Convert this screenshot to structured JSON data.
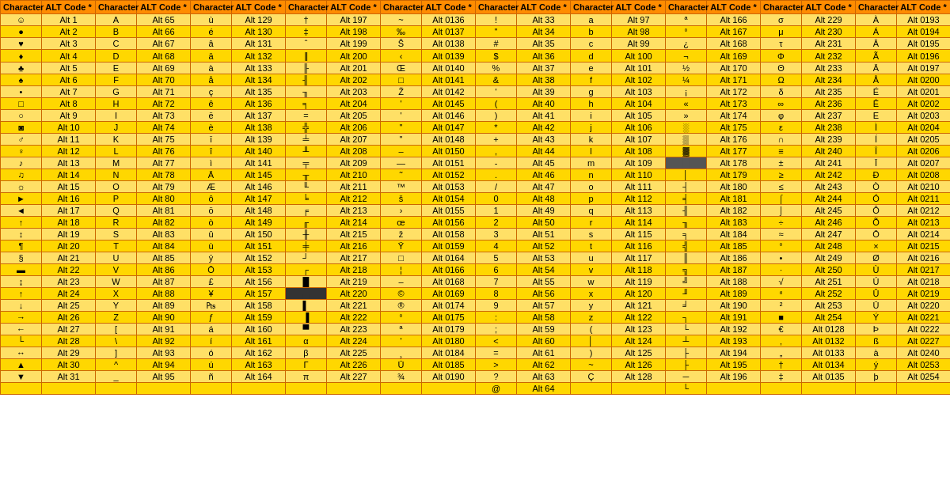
{
  "table": {
    "headers": [
      "Character",
      "ALT Code *",
      "Character",
      "ALT Code *",
      "Character",
      "ALT Code *",
      "Character",
      "ALT Code *",
      "Character",
      "ALT Code *"
    ],
    "rows": [
      [
        "☺",
        "Alt 1",
        "A",
        "Alt 65",
        "ù",
        "Alt 129",
        "†",
        "Alt 197",
        "~",
        "Alt 0136"
      ],
      [
        "●",
        "Alt 2",
        "B",
        "Alt 66",
        "é",
        "Alt 130",
        "‡",
        "Alt 198",
        "‰",
        "Alt 0137"
      ],
      [
        "♥",
        "Alt 3",
        "C",
        "Alt 67",
        "â",
        "Alt 131",
        "ˆ",
        "Alt 199",
        "Š",
        "Alt 0138"
      ],
      [
        "♦",
        "Alt 4",
        "D",
        "Alt 68",
        "ä",
        "Alt 132",
        "‖",
        "Alt 200",
        "‹",
        "Alt 0139"
      ],
      [
        "♣",
        "Alt 5",
        "E",
        "Alt 69",
        "à",
        "Alt 133",
        "╟",
        "Alt 201",
        "Œ",
        "Alt 0140"
      ],
      [
        "♠",
        "Alt 6",
        "F",
        "Alt 70",
        "å",
        "Alt 134",
        "╢",
        "Alt 202",
        "□",
        "Alt 0141"
      ],
      [
        "•",
        "Alt 7",
        "G",
        "Alt 71",
        "ç",
        "Alt 135",
        "╖",
        "Alt 203",
        "Ž",
        "Alt 0142"
      ],
      [
        "□",
        "Alt 8",
        "H",
        "Alt 72",
        "ê",
        "Alt 136",
        "╕",
        "Alt 204",
        "'",
        "Alt 0145"
      ],
      [
        "○",
        "Alt 9",
        "I",
        "Alt 73",
        "ë",
        "Alt 137",
        "=",
        "Alt 205",
        "'",
        "Alt 0146"
      ],
      [
        "◙",
        "Alt 10",
        "J",
        "Alt 74",
        "è",
        "Alt 138",
        "╬",
        "Alt 206",
        "\"",
        "Alt 0147"
      ],
      [
        "♂",
        "Alt 11",
        "K",
        "Alt 75",
        "ï",
        "Alt 139",
        "╧",
        "Alt 207",
        "\"",
        "Alt 0148"
      ],
      [
        "♀",
        "Alt 12",
        "L",
        "Alt 76",
        "î",
        "Alt 140",
        "╨",
        "Alt 208",
        "–",
        "Alt 0150"
      ],
      [
        "♪",
        "Alt 13",
        "M",
        "Alt 77",
        "ì",
        "Alt 141",
        "╤",
        "Alt 209",
        "—",
        "Alt 0151"
      ],
      [
        "♫",
        "Alt 14",
        "N",
        "Alt 78",
        "Ä",
        "Alt 145",
        "╥",
        "Alt 210",
        "˜",
        "Alt 0152"
      ],
      [
        "☼",
        "Alt 15",
        "O",
        "Alt 79",
        "Æ",
        "Alt 146",
        "╙",
        "Alt 211",
        "™",
        "Alt 0153"
      ],
      [
        "►",
        "Alt 16",
        "P",
        "Alt 80",
        "ô",
        "Alt 147",
        "╘",
        "Alt 212",
        "š",
        "Alt 0154"
      ],
      [
        "◄",
        "Alt 17",
        "Q",
        "Alt 81",
        "ö",
        "Alt 148",
        "╒",
        "Alt 213",
        "›",
        "Alt 0155"
      ],
      [
        "↑",
        "Alt 18",
        "R",
        "Alt 82",
        "ò",
        "Alt 149",
        "╓",
        "Alt 214",
        "œ",
        "Alt 0156"
      ],
      [
        "↕",
        "Alt 19",
        "S",
        "Alt 83",
        "û",
        "Alt 150",
        "╫",
        "Alt 215",
        "ž",
        "Alt 0158"
      ],
      [
        "¶",
        "Alt 20",
        "T",
        "Alt 84",
        "ù",
        "Alt 151",
        "╪",
        "Alt 216",
        "Ÿ",
        "Alt 0159"
      ],
      [
        "§",
        "Alt 21",
        "U",
        "Alt 85",
        "ÿ",
        "Alt 152",
        "┘",
        "Alt 217",
        "□",
        "Alt 0164"
      ],
      [
        "▬",
        "Alt 22",
        "V",
        "Alt 86",
        "Ö",
        "Alt 153",
        "┌",
        "Alt 218",
        "¦",
        "Alt 0166"
      ],
      [
        "↨",
        "Alt 23",
        "W",
        "Alt 87",
        "£",
        "Alt 156",
        "█",
        "Alt 219",
        "–",
        "Alt 0168"
      ],
      [
        "↑",
        "Alt 24",
        "X",
        "Alt 88",
        "¥",
        "Alt 157",
        "▄",
        "Alt 220",
        "©",
        "Alt 0169"
      ],
      [
        "↓",
        "Alt 25",
        "Y",
        "Alt 89",
        "₧",
        "Alt 158",
        "▌",
        "Alt 221",
        "®",
        "Alt 0174"
      ],
      [
        "→",
        "Alt 26",
        "Z",
        "Alt 90",
        "ƒ",
        "Alt 159",
        "▐",
        "Alt 222",
        "°",
        "Alt 0175"
      ],
      [
        "←",
        "Alt 27",
        "[",
        "Alt 91",
        "á",
        "Alt 160",
        "▀",
        "Alt 223",
        "ª",
        "Alt 0179"
      ],
      [
        "└",
        "Alt 28",
        "\\",
        "Alt 92",
        "í",
        "Alt 161",
        "α",
        "Alt 224",
        "'",
        "Alt 0180"
      ],
      [
        "↔",
        "Alt 29",
        "]",
        "Alt 93",
        "ó",
        "Alt 162",
        "β",
        "Alt 225",
        "¸",
        "Alt 0184"
      ],
      [
        "▲",
        "Alt 30",
        "^",
        "Alt 94",
        "ú",
        "Alt 163",
        "Γ",
        "Alt 226",
        "Ü",
        "Alt 0185"
      ],
      [
        "▼",
        "Alt 31",
        "_",
        "Alt 95",
        "ñ",
        "Alt 164",
        "π",
        "Alt 227",
        "¾",
        "Alt 0190"
      ]
    ],
    "extended_cols": [
      [
        "!",
        "Alt 33",
        "a",
        "Alt 97",
        "ª",
        "Alt 166",
        "σ",
        "Alt 229",
        "À",
        "Alt 0193"
      ],
      [
        "\"",
        "Alt 34",
        "b",
        "Alt 98",
        "°",
        "Alt 167",
        "μ",
        "Alt 230",
        "Á",
        "Alt 0194"
      ],
      [
        "#",
        "Alt 35",
        "c",
        "Alt 99",
        "¿",
        "Alt 168",
        "τ",
        "Alt 231",
        "Â",
        "Alt 0195"
      ],
      [
        "$",
        "Alt 36",
        "d",
        "Alt 100",
        "¬",
        "Alt 169",
        "Φ",
        "Alt 232",
        "Ã",
        "Alt 0196"
      ],
      [
        "%",
        "Alt 37",
        "e",
        "Alt 101",
        "½",
        "Alt 170",
        "Θ",
        "Alt 233",
        "Ä",
        "Alt 0197"
      ],
      [
        "&",
        "Alt 38",
        "f",
        "Alt 102",
        "¼",
        "Alt 171",
        "Ω",
        "Alt 234",
        "Å",
        "Alt 0200"
      ],
      [
        "'",
        "Alt 39",
        "g",
        "Alt 103",
        "¡",
        "Alt 172",
        "δ",
        "Alt 235",
        "É",
        "Alt 0201"
      ],
      [
        "(",
        "Alt 40",
        "h",
        "Alt 104",
        "«",
        "Alt 173",
        "∞",
        "Alt 236",
        "Ê",
        "Alt 0202"
      ],
      [
        ")",
        "Alt 41",
        "i",
        "Alt 105",
        "»",
        "Alt 174",
        "φ",
        "Alt 237",
        "E",
        "Alt 0203"
      ],
      [
        "*",
        "Alt 42",
        "j",
        "Alt 106",
        "░",
        "Alt 175",
        "ε",
        "Alt 238",
        "Ì",
        "Alt 0204"
      ],
      [
        "+",
        "Alt 43",
        "k",
        "Alt 107",
        "▒",
        "Alt 176",
        "∩",
        "Alt 239",
        "Í",
        "Alt 0205"
      ],
      [
        ",",
        "Alt 44",
        "l",
        "Alt 108",
        "▓",
        "Alt 177",
        "≡",
        "Alt 240",
        "Î",
        "Alt 0206"
      ],
      [
        "-",
        "Alt 45",
        "m",
        "Alt 109",
        "█",
        "Alt 178",
        "±",
        "Alt 241",
        "Ï",
        "Alt 0207"
      ],
      [
        ".",
        "Alt 46",
        "n",
        "Alt 110",
        "│",
        "Alt 179",
        "≥",
        "Alt 242",
        "Ð",
        "Alt 0208"
      ],
      [
        "/",
        "Alt 47",
        "o",
        "Alt 111",
        "┤",
        "Alt 180",
        "≤",
        "Alt 243",
        "Ò",
        "Alt 0210"
      ],
      [
        "0",
        "Alt 48",
        "p",
        "Alt 112",
        "╡",
        "Alt 181",
        "⌠",
        "Alt 244",
        "Ó",
        "Alt 0211"
      ],
      [
        "1",
        "Alt 49",
        "q",
        "Alt 113",
        "╢",
        "Alt 182",
        "⌡",
        "Alt 245",
        "Ô",
        "Alt 0212"
      ],
      [
        "2",
        "Alt 50",
        "r",
        "Alt 114",
        "╖",
        "Alt 183",
        "÷",
        "Alt 246",
        "Õ",
        "Alt 0213"
      ],
      [
        "3",
        "Alt 51",
        "s",
        "Alt 115",
        "╕",
        "Alt 184",
        "≈",
        "Alt 247",
        "Ö",
        "Alt 0214"
      ],
      [
        "4",
        "Alt 52",
        "t",
        "Alt 116",
        "╣",
        "Alt 185",
        "°",
        "Alt 248",
        "×",
        "Alt 0215"
      ],
      [
        "5",
        "Alt 53",
        "u",
        "Alt 117",
        "║",
        "Alt 186",
        "•",
        "Alt 249",
        "Ø",
        "Alt 0216"
      ],
      [
        "6",
        "Alt 54",
        "v",
        "Alt 118",
        "╗",
        "Alt 187",
        "·",
        "Alt 250",
        "Ù",
        "Alt 0217"
      ],
      [
        "7",
        "Alt 55",
        "w",
        "Alt 119",
        "╝",
        "Alt 188",
        "√",
        "Alt 251",
        "Ú",
        "Alt 0218"
      ],
      [
        "8",
        "Alt 56",
        "x",
        "Alt 120",
        "╜",
        "Alt 189",
        "ⁿ",
        "Alt 252",
        "Û",
        "Alt 0219"
      ],
      [
        "9",
        "Alt 57",
        "y",
        "Alt 121",
        "╛",
        "Alt 190",
        "²",
        "Alt 253",
        "Ü",
        "Alt 0220"
      ],
      [
        ":",
        "Alt 58",
        "z",
        "Alt 122",
        "┐",
        "Alt 191",
        "■",
        "Alt 254",
        "Ý",
        "Alt 0221"
      ],
      [
        ";",
        "Alt 59",
        "(",
        "Alt 123",
        "└",
        "Alt 192",
        "€",
        "Alt 0128",
        "Þ",
        "Alt 0222"
      ],
      [
        "<",
        "Alt 60",
        "│",
        "Alt 124",
        "┴",
        "Alt 193",
        "‚",
        "Alt 0132",
        "ß",
        "Alt 0227"
      ],
      [
        "=",
        "Alt 61",
        ")",
        "Alt 125",
        "├",
        "Alt 194",
        "„",
        "Alt 0133",
        "à",
        "Alt 0240"
      ],
      [
        ">",
        "Alt 62",
        "~",
        "Alt 126",
        "├",
        "Alt 195",
        "†",
        "Alt 0134",
        "ý",
        "Alt 0253"
      ],
      [
        "?",
        "Alt 63",
        "Ç",
        "Alt 128",
        "─",
        "Alt 196",
        "‡",
        "Alt 0135",
        "þ",
        "Alt 0254"
      ],
      [
        "@",
        "Alt 64",
        "",
        "",
        "└",
        "",
        "",
        "",
        "",
        ""
      ]
    ]
  }
}
